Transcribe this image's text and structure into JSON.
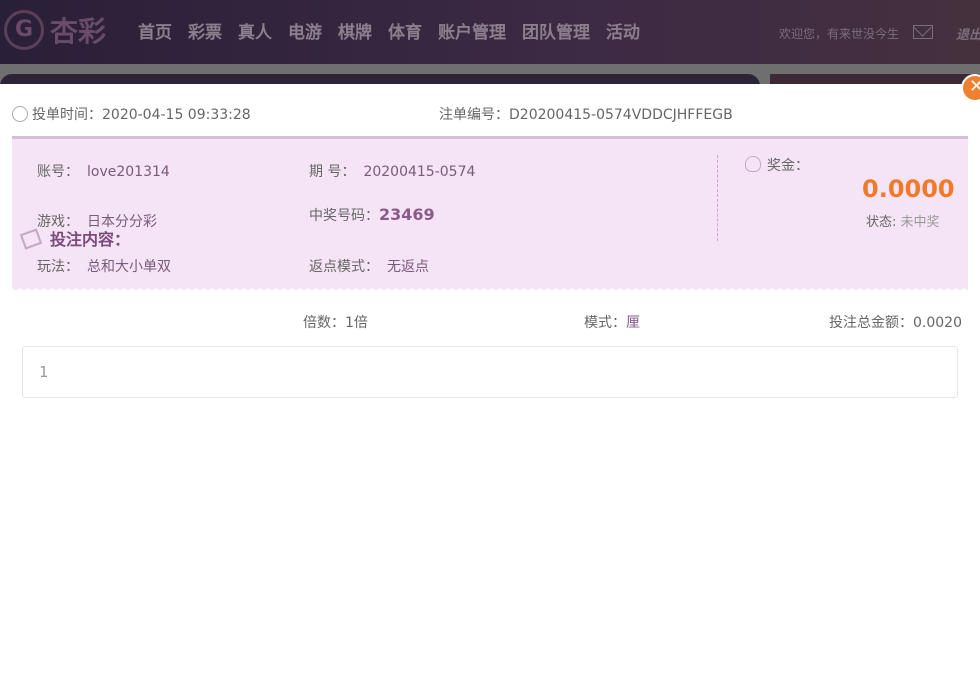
{
  "header": {
    "logo": "杏彩",
    "nav": [
      "首页",
      "彩票",
      "真人",
      "电游",
      "棋牌",
      "体育",
      "账户管理",
      "团队管理",
      "活动"
    ],
    "welcome": "欢迎您，有来世没今生",
    "logout": "退出"
  },
  "order": {
    "time_label": "投单时间：",
    "time": "2020-04-15 09:33:28",
    "id_label": "注单编号：",
    "id": "D20200415-0574VDDCJHFFEGB"
  },
  "info": {
    "account_label": "账号：",
    "account": "love201314",
    "issue_label": "期 号：",
    "issue": "20200415-0574",
    "game_label": "游戏：",
    "game": "日本分分彩",
    "win_label": "中奖号码：",
    "win": "23469",
    "play_label": "玩法：",
    "play": "总和大小单双",
    "rebate_label": "返点模式：",
    "rebate": "无返点",
    "prize_label": "奖金：",
    "prize": "0.0000",
    "status_label": "状态:",
    "status": "未中奖"
  },
  "bet": {
    "title": "投注内容：",
    "multiple_label": "倍数：",
    "multiple": "1倍",
    "mode_label": "模式：",
    "mode": "厘",
    "total_label": "投注总金额：",
    "total": "0.0020",
    "content": "1"
  },
  "colors": {
    "accent": "#f07a2a",
    "panel": "#f5e4f5",
    "header": "#2a1f38"
  }
}
